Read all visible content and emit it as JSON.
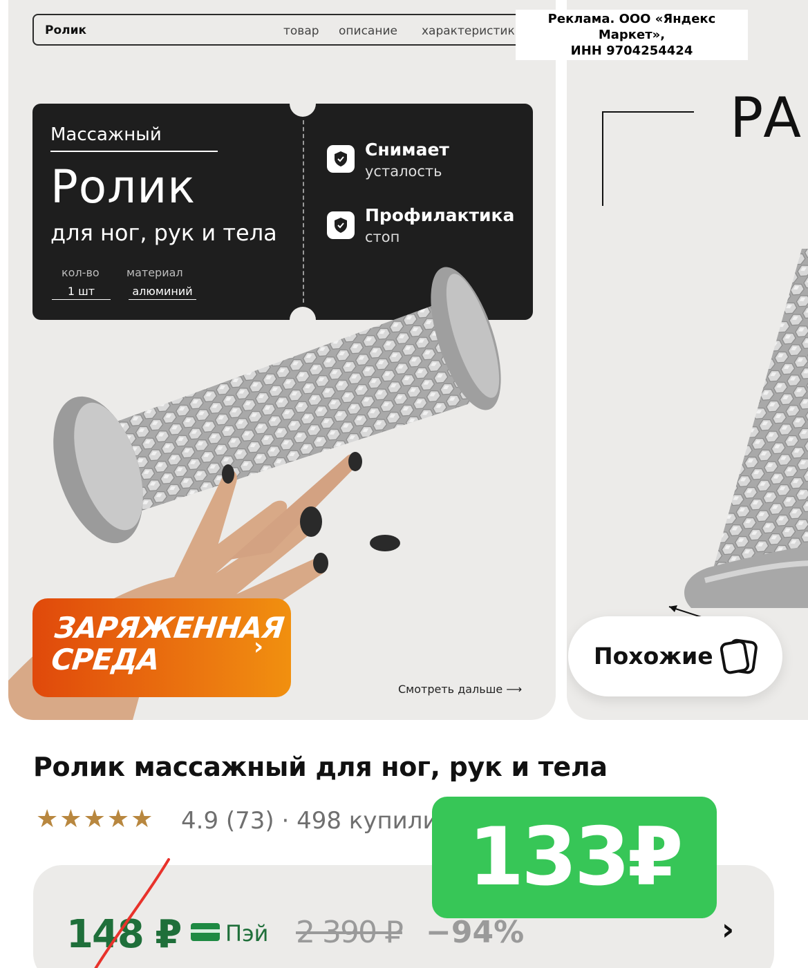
{
  "ad": {
    "line1": "Реклама. ООО «Яндекс Маркет»,",
    "line2": "ИНН 9704254424"
  },
  "gallery": {
    "nav": {
      "brand": "Ролик",
      "links": [
        "товар",
        "описание",
        "характеристики"
      ]
    },
    "ticket": {
      "pre_title": "Массажный",
      "title": "Ролик",
      "subtitle": "для ног, рук и тела",
      "specs": [
        {
          "key": "кол-во",
          "value": "1 шт"
        },
        {
          "key": "материал",
          "value": "алюминий"
        }
      ],
      "features": [
        {
          "icon": "shield-check-icon",
          "title": "Снимает",
          "sub": "усталость"
        },
        {
          "icon": "shield-check-icon",
          "title": "Профилактика",
          "sub": "стоп"
        }
      ]
    },
    "promo": {
      "line1": "ЗАРЯЖЕННАЯ",
      "line2": "СРЕДА",
      "chevron": "›"
    },
    "see_more": "Смотреть дальше ⟶",
    "next_card": {
      "letters": "РА",
      "similar_label": "Похожие",
      "similar_icon": "cards-stack-icon"
    }
  },
  "product": {
    "title": "Ролик массажный для ног, рук и тела",
    "rating_text": "4.9  (73) · 498 купили",
    "stars_count": 5,
    "star_color": "#b8873f"
  },
  "pricing": {
    "current_price": "148 ₽",
    "pay_label": "Пэй",
    "old_price": "2 390 ₽",
    "discount": "−94%",
    "chevron": "›",
    "overlay_price": "133₽",
    "overlay_color": "#37c657",
    "price_color": "#1f6f3a"
  }
}
